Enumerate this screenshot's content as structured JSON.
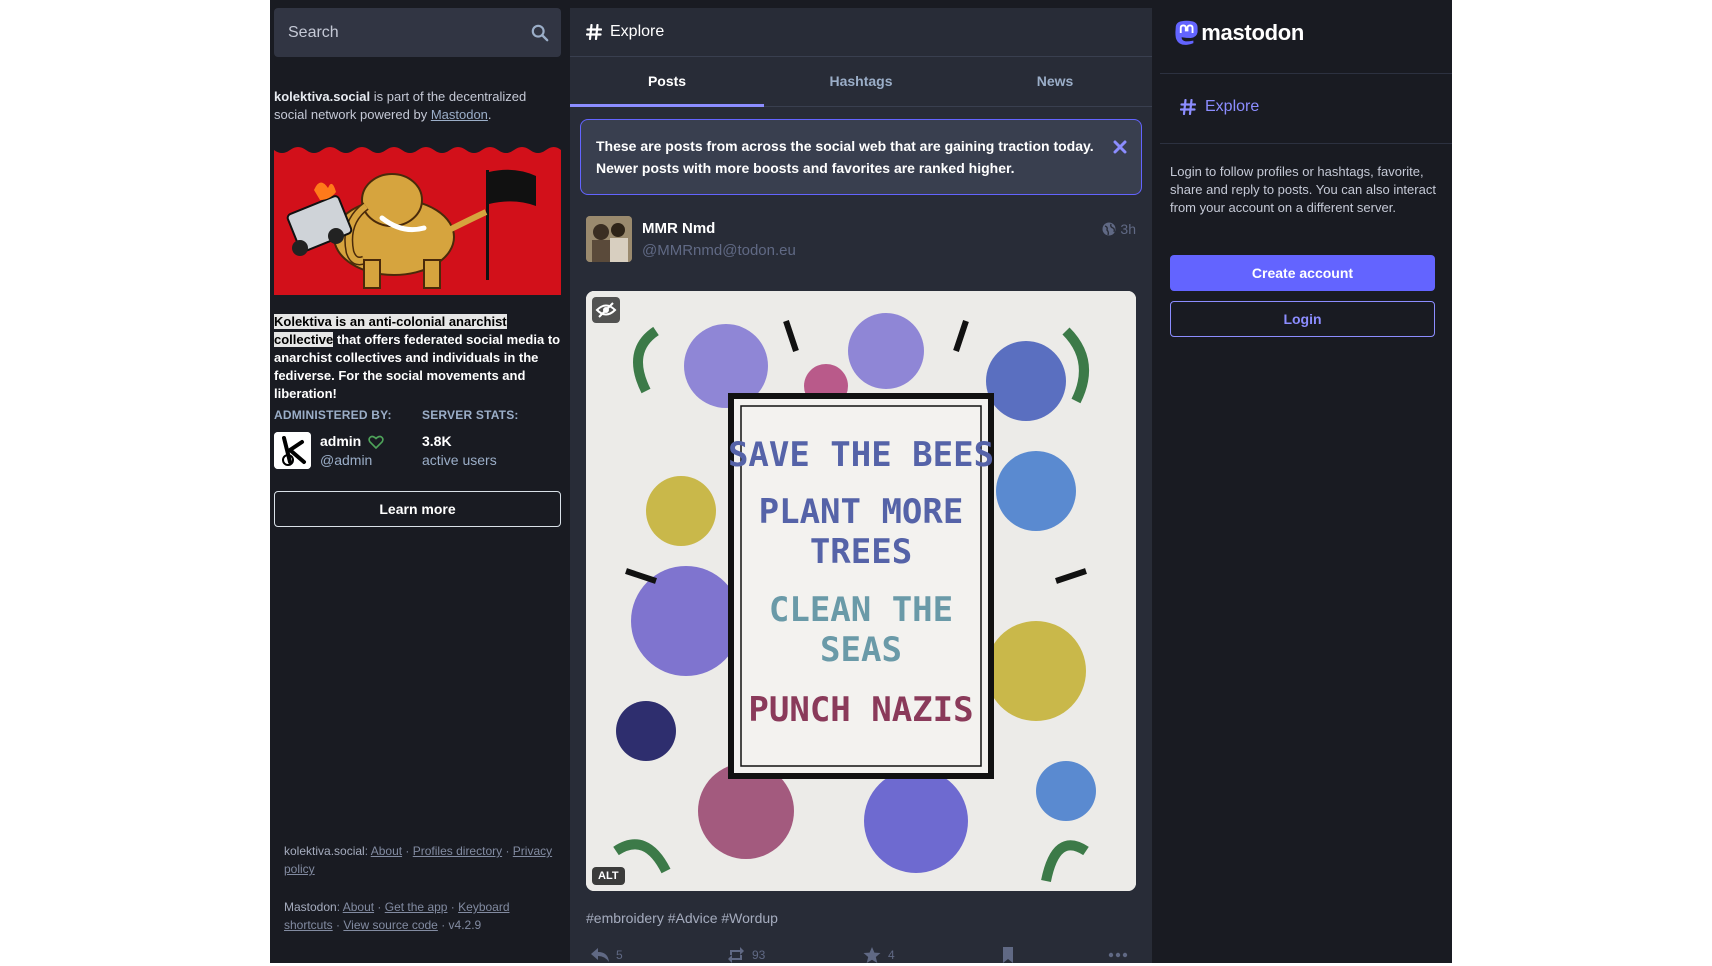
{
  "search": {
    "placeholder": "Search"
  },
  "server": {
    "domain": "kolektiva.social",
    "about_middle": " is part of the decentralized social network powered by ",
    "about_link": "Mastodon",
    "about_end": ".",
    "description_highlight": "Kolektiva is an anti-colonial anarchist collective",
    "description_rest": " that offers federated social media to anarchist collectives and individuals in the fediverse. For the social movements and liberation!",
    "administered_by_label": "ADMINISTERED BY:",
    "server_stats_label": "SERVER STATS:",
    "admin_name": "admin",
    "admin_handle": "@admin",
    "active_users_value": "3.8K",
    "active_users_label": "active users",
    "learn_more": "Learn more"
  },
  "footer": {
    "server_name": "kolektiva.social",
    "server_links": [
      "About",
      "Profiles directory",
      "Privacy policy"
    ],
    "mastodon_name": "Mastodon",
    "mastodon_links": [
      "About",
      "Get the app",
      "Keyboard shortcuts",
      "View source code"
    ],
    "version": "v4.2.9"
  },
  "column": {
    "title": "Explore",
    "tabs": [
      "Posts",
      "Hashtags",
      "News"
    ],
    "active_tab": "Posts",
    "notice": "These are posts from across the social web that are gaining traction today. Newer posts with more boosts and favorites are ranked higher."
  },
  "post": {
    "display_name": "MMR Nmd",
    "handle": "@MMRnmd@todon.eu",
    "time": "3h",
    "image_lines": [
      "SAVE THE BEES",
      "PLANT MORE",
      "TREES",
      "CLEAN THE",
      "SEAS",
      "PUNCH NAZIS"
    ],
    "alt_badge": "ALT",
    "hashtags": "#embroidery #Advice #Wordup",
    "replies": "5",
    "boosts": "93",
    "favorites": "4"
  },
  "sidebar": {
    "logo_text": "mastodon",
    "nav_explore": "Explore",
    "login_prompt": "Login to follow profiles or hashtags, favorite, share and reply to posts. You can also interact from your account on a different server.",
    "create_account": "Create account",
    "login": "Login"
  },
  "colors": {
    "background": "#191b22",
    "column": "#282c37",
    "accent": "#6364ff",
    "accent_light": "#8c8dff",
    "muted": "#606984"
  }
}
